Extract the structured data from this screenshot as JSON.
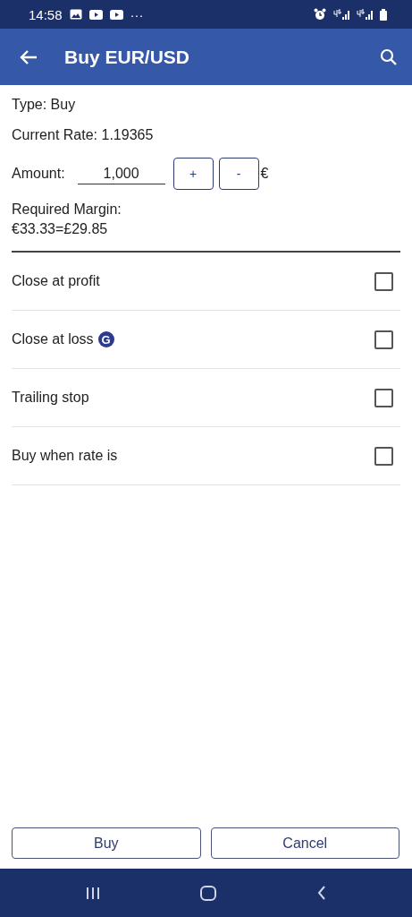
{
  "status_bar": {
    "time": "14:58",
    "more": "···"
  },
  "app_bar": {
    "title": "Buy EUR/USD"
  },
  "info": {
    "type": "Type: Buy",
    "rate": "Current Rate: 1.19365"
  },
  "amount": {
    "label": "Amount:",
    "value": "1,000",
    "plus": "+",
    "minus": "-",
    "currency": "€"
  },
  "margin": {
    "label": "Required Margin:",
    "value": "€33.33=£29.85"
  },
  "options": [
    {
      "label": "Close at profit",
      "checked": false
    },
    {
      "label": "Close at loss",
      "badge": "G",
      "checked": false
    },
    {
      "label": "Trailing stop",
      "checked": false
    },
    {
      "label": "Buy when rate is",
      "checked": false
    }
  ],
  "buttons": [
    "Buy",
    "Cancel"
  ]
}
